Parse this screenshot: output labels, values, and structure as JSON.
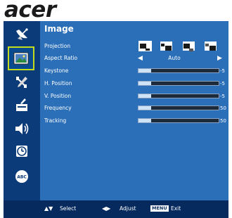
{
  "logo": {
    "text": "acer"
  },
  "sidebar": {
    "items": [
      {
        "icon": "satellite-dish-icon",
        "active": false
      },
      {
        "icon": "image-icon",
        "active": true
      },
      {
        "icon": "tools-icon",
        "active": false
      },
      {
        "icon": "setup-icon",
        "active": false
      },
      {
        "icon": "speaker-icon",
        "active": false
      },
      {
        "icon": "timer-icon",
        "active": false
      },
      {
        "icon": "language-abc-icon",
        "active": false
      }
    ]
  },
  "panel": {
    "title": "Image",
    "rows": {
      "projection": {
        "label": "Projection"
      },
      "aspect": {
        "label": "Aspect Ratio",
        "value": "Auto"
      },
      "keystone": {
        "label": "Keystone",
        "value": "-5",
        "level": 0.16
      },
      "hposition": {
        "label": "H. Position",
        "value": "-5",
        "level": 0.16
      },
      "vposition": {
        "label": "V. Position",
        "value": "-5",
        "level": 0.16
      },
      "frequency": {
        "label": "Frequency",
        "value": "50",
        "level": 0.16
      },
      "tracking": {
        "label": "Tracking",
        "value": "50",
        "level": 0.16
      }
    }
  },
  "legend": {
    "select_label": "Select",
    "adjust_label": "Adjust",
    "menu_key": "MENU",
    "exit_label": "Exit"
  },
  "colors": {
    "sidebar": "#0b3b78",
    "panel": "#2a6fb8",
    "active_border": "#c2dc1c",
    "legend": "#062a5e"
  }
}
